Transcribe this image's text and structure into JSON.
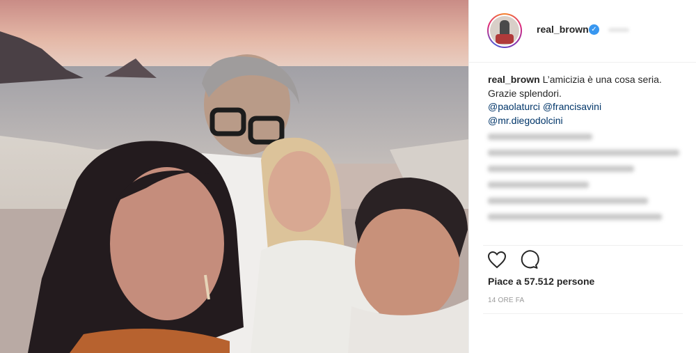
{
  "post": {
    "username": "real_brown",
    "verified_glyph": "✓",
    "caption": {
      "text_line1": "L’amicizia è una cosa seria.",
      "text_line2": "Grazie splendori.",
      "mentions": [
        "@paolaturci",
        "@francisavini",
        "@mr.diegodolcini"
      ]
    },
    "likes_text": "Piace a 57.512 persone",
    "time_text": "14 ORE FA"
  },
  "icons": {
    "like": "heart-icon",
    "comment": "comment-icon",
    "verified": "verified-badge-icon"
  },
  "colors": {
    "link": "#003569",
    "verified": "#3897f0",
    "muted": "#999999"
  }
}
